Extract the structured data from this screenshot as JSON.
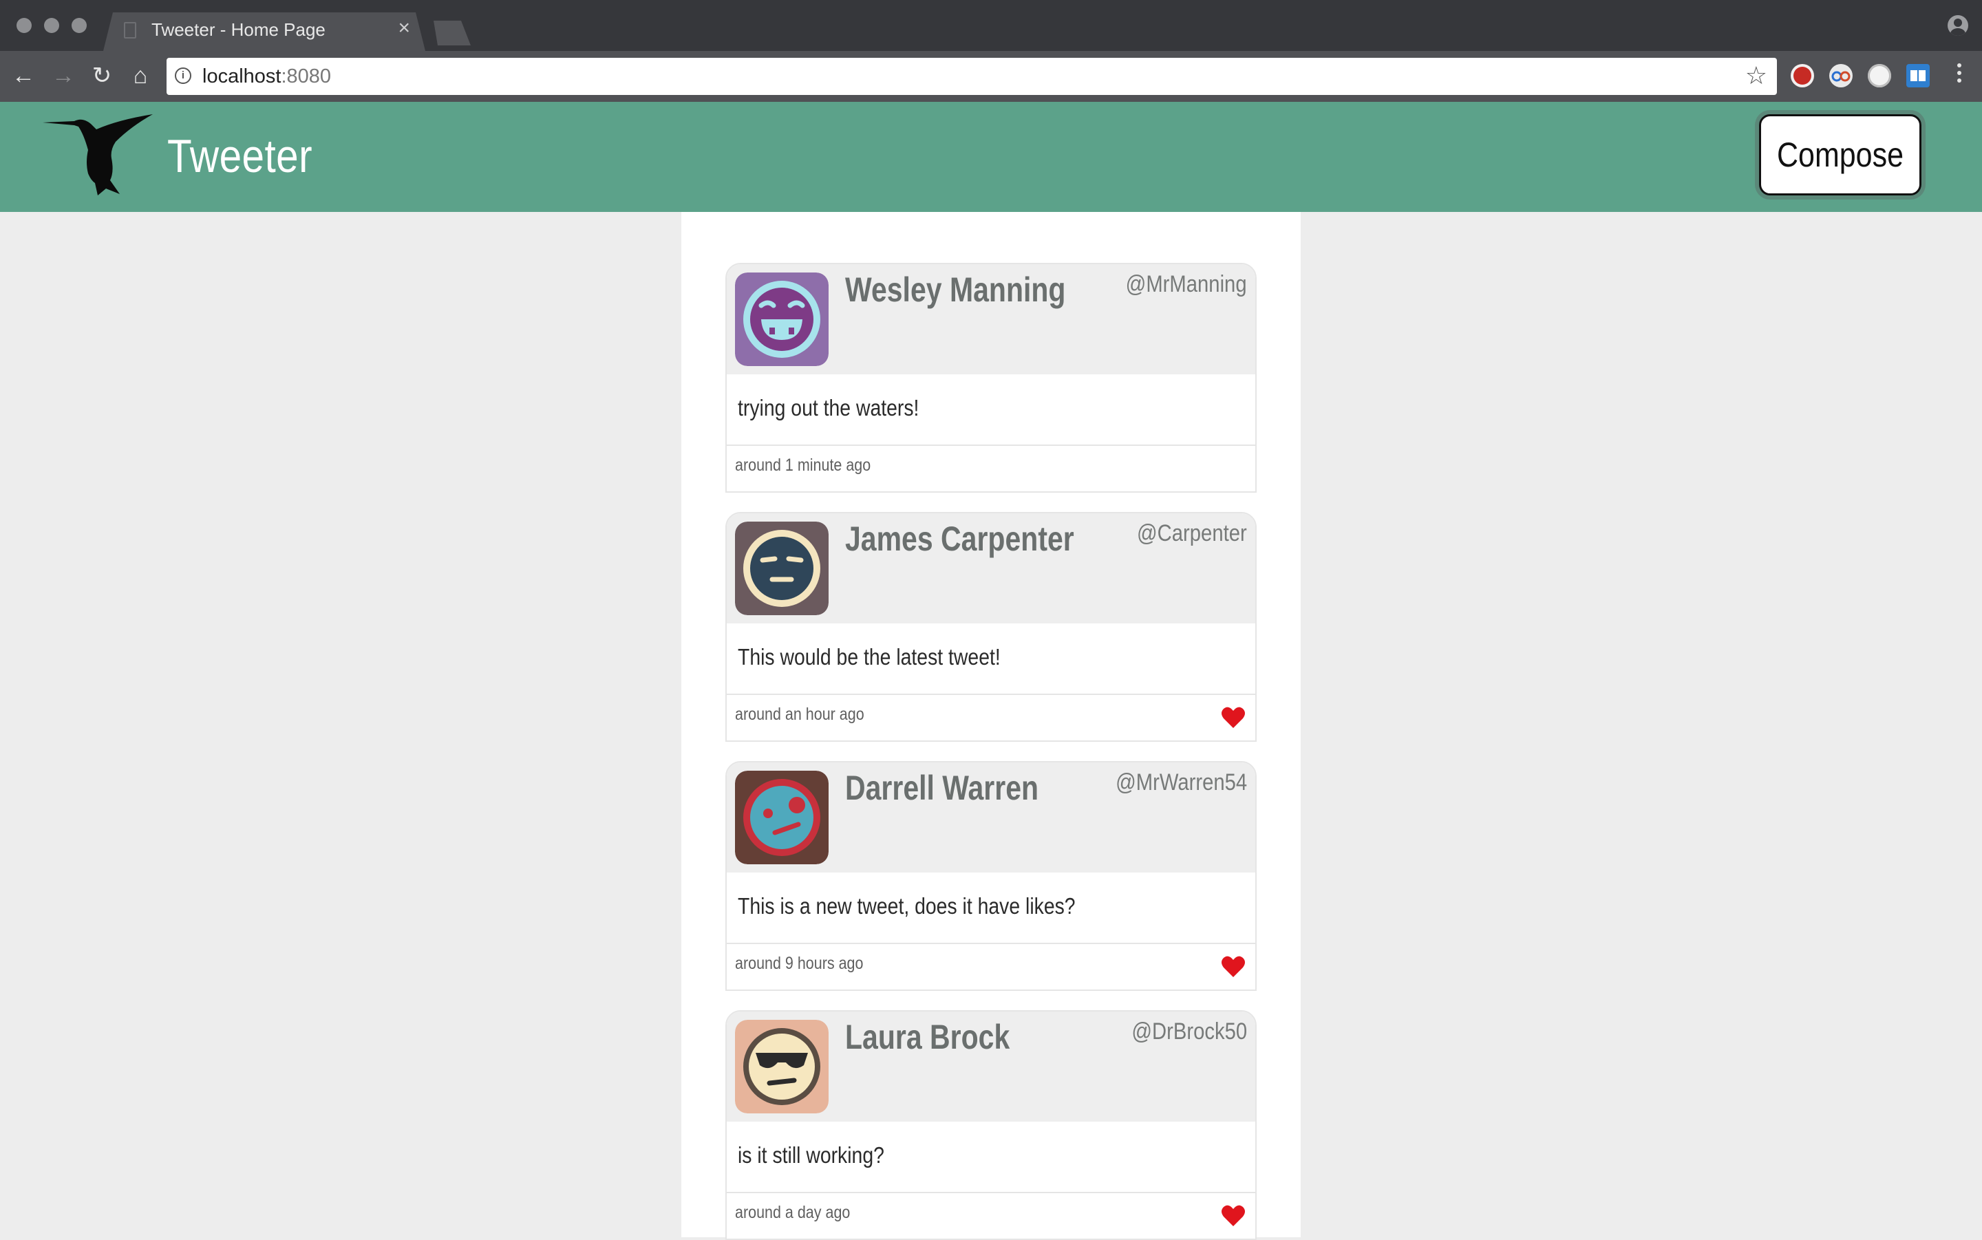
{
  "browser": {
    "tab_title": "Tweeter - Home Page",
    "tab_close": "×",
    "url_host": "localhost",
    "url_port": ":8080",
    "nav": {
      "back": "←",
      "forward": "→",
      "reload": "↻",
      "home": "⌂"
    },
    "bookmark_star": "☆",
    "extensions": [
      "ublock-icon",
      "glasses-icon",
      "circle-icon",
      "reader-icon"
    ]
  },
  "header": {
    "brand": "Tweeter",
    "compose_label": "Compose",
    "logo_icon": "hummingbird-logo",
    "color": "#5ca28a"
  },
  "tweets": [
    {
      "name": "Wesley Manning",
      "handle": "@MrManning",
      "text": "trying out the waters!",
      "time": "around 1 minute ago",
      "liked": false,
      "avatar": {
        "bg": "#8e6eaa",
        "ring": "#a7e3ec",
        "face": "#7e3b86",
        "style": "grin"
      }
    },
    {
      "name": "James Carpenter",
      "handle": "@Carpenter",
      "text": "This would be the latest tweet!",
      "time": "around an hour ago",
      "liked": true,
      "avatar": {
        "bg": "#6b5a5e",
        "ring": "#f4e5bf",
        "face": "#2f4659",
        "style": "meh"
      }
    },
    {
      "name": "Darrell Warren",
      "handle": "@MrWarren54",
      "text": "This is a new tweet, does it have likes?",
      "time": "around 9 hours ago",
      "liked": true,
      "avatar": {
        "bg": "#643f36",
        "ring": "#c8303c",
        "face": "#4fa9bd",
        "style": "dizzy"
      }
    },
    {
      "name": "Laura Brock",
      "handle": "@DrBrock50",
      "text": "is it still working?",
      "time": "around a day ago",
      "liked": true,
      "avatar": {
        "bg": "#e7b49b",
        "ring": "#f6e7bf",
        "face": "#f6e7bf",
        "style": "shades"
      }
    }
  ],
  "colors": {
    "heart": "#e0151d",
    "name_text": "#6a6f6e",
    "page_bg": "#ededed"
  }
}
